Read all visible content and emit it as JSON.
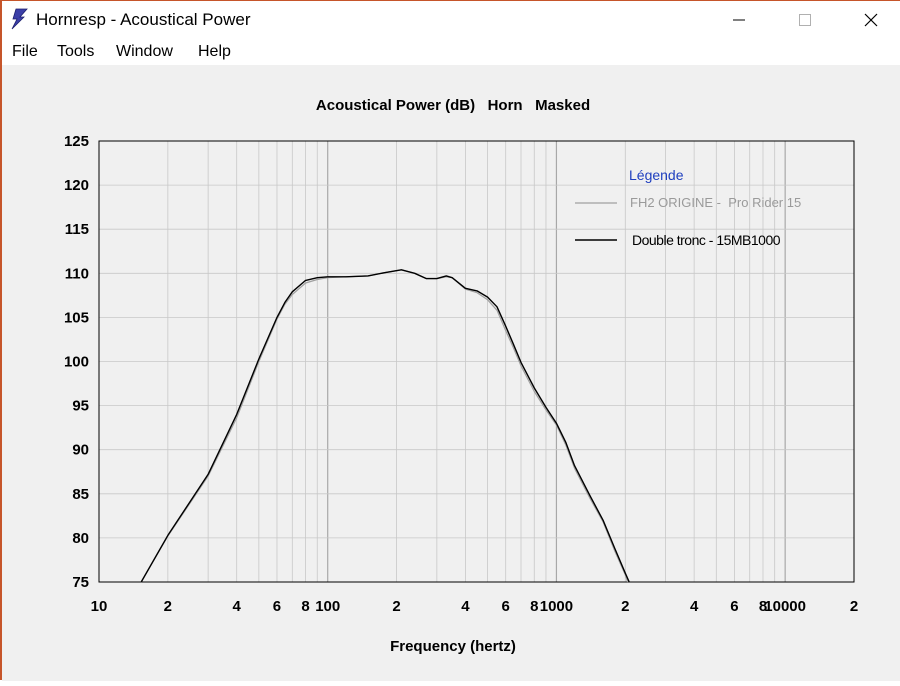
{
  "window": {
    "title": "Hornresp - Acoustical Power",
    "icon": "hornresp-lightning-icon",
    "controls": [
      "minimize-icon",
      "maximize-icon",
      "close-icon"
    ]
  },
  "menu": {
    "file": "File",
    "tools": "Tools",
    "window": "Window",
    "help": "Help"
  },
  "colors": {
    "series1": "#a0a0a0",
    "series2": "#000000",
    "legend_title": "#1f3fbf",
    "grid": "#c8c8c8"
  },
  "chart_data": {
    "type": "line",
    "title": "Acoustical Power (dB)   Horn   Masked",
    "xlabel": "Frequency (hertz)",
    "ylabel": "",
    "x_scale": "log",
    "xlim": [
      10,
      20000
    ],
    "ylim": [
      75,
      125
    ],
    "grid": true,
    "legend_position": "top-right",
    "legend_title": "Légende",
    "x_tick_labels": [
      {
        "value": 10,
        "label": "10"
      },
      {
        "value": 20,
        "label": "2"
      },
      {
        "value": 40,
        "label": "4"
      },
      {
        "value": 60,
        "label": "6"
      },
      {
        "value": 80,
        "label": "8"
      },
      {
        "value": 100,
        "label": "100"
      },
      {
        "value": 200,
        "label": "2"
      },
      {
        "value": 400,
        "label": "4"
      },
      {
        "value": 600,
        "label": "6"
      },
      {
        "value": 800,
        "label": "8"
      },
      {
        "value": 1000,
        "label": "1000"
      },
      {
        "value": 2000,
        "label": "2"
      },
      {
        "value": 4000,
        "label": "4"
      },
      {
        "value": 6000,
        "label": "6"
      },
      {
        "value": 8000,
        "label": "8"
      },
      {
        "value": 10000,
        "label": "10000"
      },
      {
        "value": 20000,
        "label": "2"
      }
    ],
    "y_ticks": [
      75,
      80,
      85,
      90,
      95,
      100,
      105,
      110,
      115,
      120,
      125
    ],
    "series": [
      {
        "name": "FH2 ORIGINE -  Pro Rider 15",
        "color": "#a0a0a0",
        "points": [
          [
            15.3,
            75
          ],
          [
            20,
            80.2
          ],
          [
            30,
            87
          ],
          [
            40,
            93.6
          ],
          [
            50,
            100
          ],
          [
            60,
            104.8
          ],
          [
            65,
            106.5
          ],
          [
            70,
            107.6
          ],
          [
            80,
            108.9
          ],
          [
            90,
            109.3
          ],
          [
            100,
            109.5
          ],
          [
            120,
            109.6
          ],
          [
            150,
            109.7
          ],
          [
            180,
            110.1
          ],
          [
            210,
            110.4
          ],
          [
            240,
            110
          ],
          [
            270,
            109.4
          ],
          [
            300,
            109.4
          ],
          [
            330,
            109.6
          ],
          [
            350,
            109.5
          ],
          [
            400,
            108.2
          ],
          [
            450,
            107.8
          ],
          [
            500,
            107
          ],
          [
            550,
            105.8
          ],
          [
            600,
            103.5
          ],
          [
            650,
            101.5
          ],
          [
            700,
            99.5
          ],
          [
            800,
            96.6
          ],
          [
            900,
            94.5
          ],
          [
            1000,
            92.8
          ],
          [
            1100,
            90.5
          ],
          [
            1200,
            87.9
          ],
          [
            1400,
            84.5
          ],
          [
            1600,
            81.8
          ],
          [
            1800,
            78.5
          ],
          [
            2000,
            75.8
          ],
          [
            2050,
            75
          ]
        ]
      },
      {
        "name": "Double tronc - 15MB1000",
        "color": "#000000",
        "points": [
          [
            15.3,
            75
          ],
          [
            20,
            80.3
          ],
          [
            30,
            87.2
          ],
          [
            40,
            94
          ],
          [
            50,
            100.3
          ],
          [
            60,
            105
          ],
          [
            65,
            106.7
          ],
          [
            70,
            107.9
          ],
          [
            80,
            109.2
          ],
          [
            90,
            109.5
          ],
          [
            100,
            109.6
          ],
          [
            120,
            109.6
          ],
          [
            150,
            109.7
          ],
          [
            180,
            110.1
          ],
          [
            210,
            110.4
          ],
          [
            240,
            110
          ],
          [
            270,
            109.4
          ],
          [
            300,
            109.4
          ],
          [
            330,
            109.7
          ],
          [
            350,
            109.5
          ],
          [
            400,
            108.3
          ],
          [
            450,
            108
          ],
          [
            500,
            107.3
          ],
          [
            550,
            106.2
          ],
          [
            600,
            104
          ],
          [
            650,
            101.9
          ],
          [
            700,
            99.9
          ],
          [
            800,
            97
          ],
          [
            900,
            94.8
          ],
          [
            1000,
            93
          ],
          [
            1100,
            90.8
          ],
          [
            1200,
            88.2
          ],
          [
            1400,
            84.8
          ],
          [
            1600,
            82
          ],
          [
            1800,
            78.8
          ],
          [
            2000,
            76
          ],
          [
            2080,
            75
          ]
        ]
      }
    ]
  }
}
